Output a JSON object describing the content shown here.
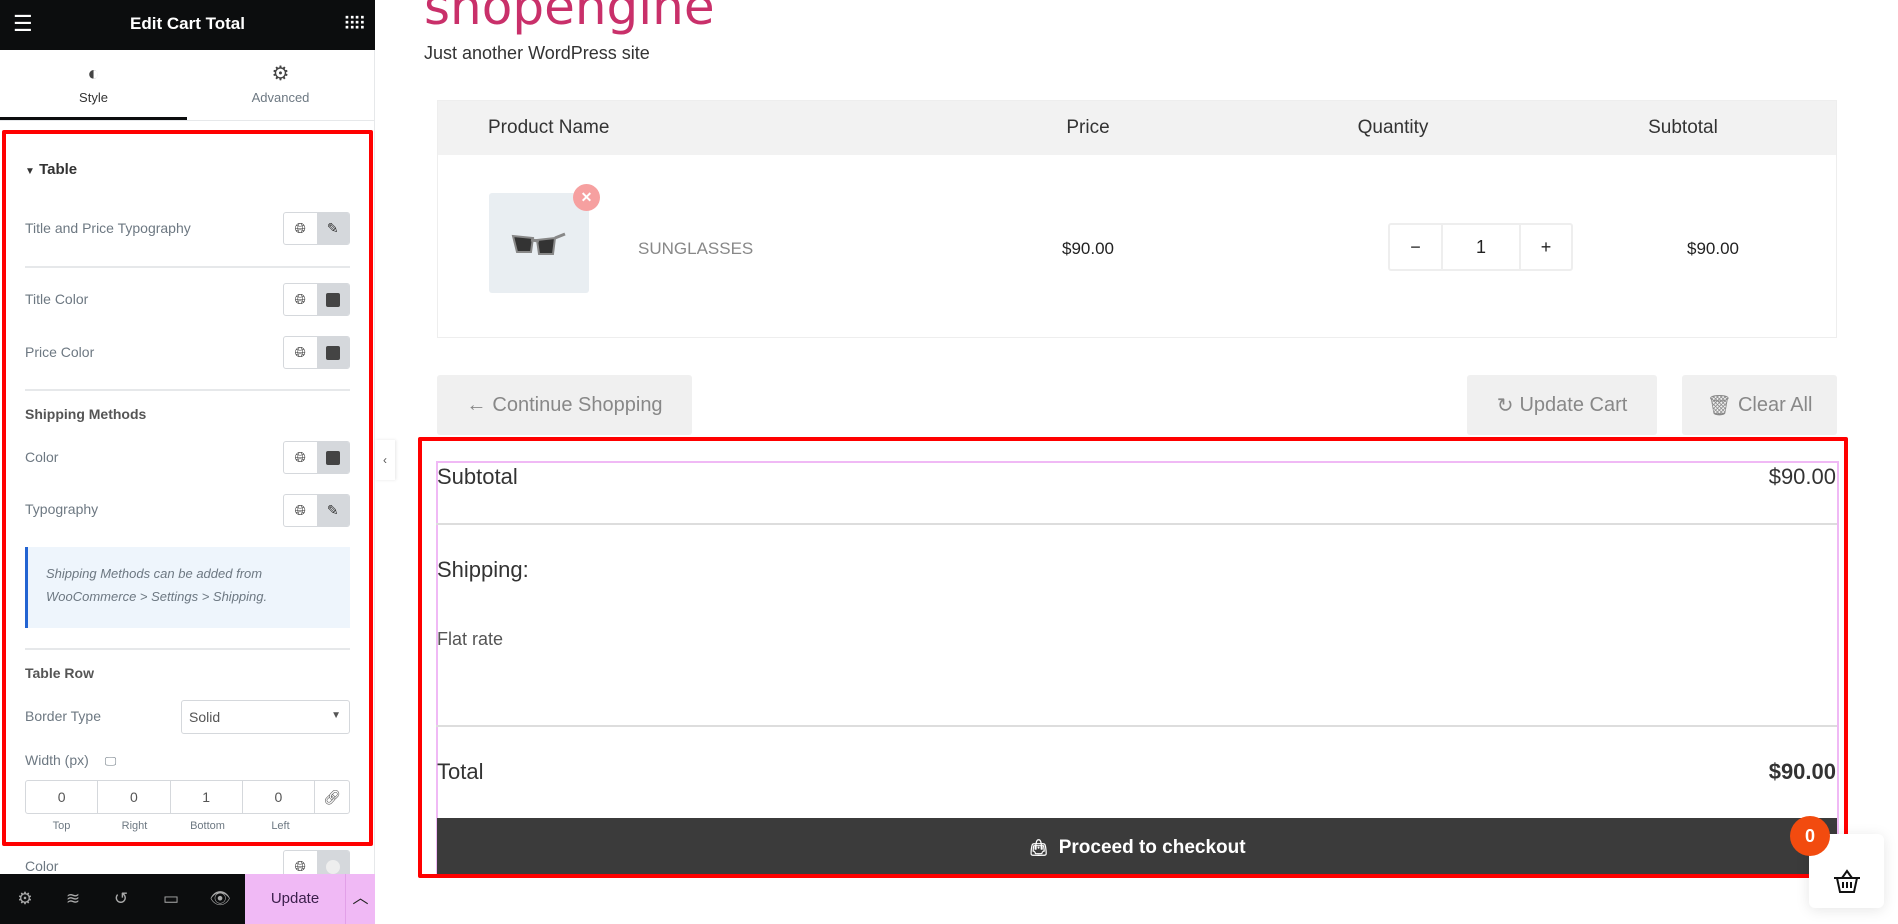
{
  "panel": {
    "title": "Edit Cart Total",
    "tabs": [
      {
        "label": "Style"
      },
      {
        "label": "Advanced"
      }
    ],
    "section": "Table",
    "controls": {
      "title_price_typography": "Title and Price Typography",
      "title_color": "Title Color",
      "price_color": "Price Color",
      "shipping_methods": "Shipping Methods",
      "color": "Color",
      "typography": "Typography",
      "info": "Shipping Methods can be added from WooCommerce > Settings > Shipping.",
      "table_row": "Table Row",
      "border_type": "Border Type",
      "border_type_value": "Solid",
      "width_label": "Width (px)",
      "dims": [
        {
          "value": "0",
          "label": "Top"
        },
        {
          "value": "0",
          "label": "Right"
        },
        {
          "value": "1",
          "label": "Bottom"
        },
        {
          "value": "0",
          "label": "Left"
        }
      ],
      "row_color": "Color"
    },
    "update": "Update"
  },
  "site": {
    "title": "shopengine",
    "tagline": "Just another WordPress site"
  },
  "cart": {
    "headers": [
      "Product Name",
      "Price",
      "Quantity",
      "Subtotal"
    ],
    "item": {
      "name": "SUNGLASSES",
      "price": "$90.00",
      "qty": "1",
      "subtotal": "$90.00"
    },
    "continue": "Continue Shopping",
    "update": "Update Cart",
    "clear": "Clear All"
  },
  "totals": {
    "subtotal_label": "Subtotal",
    "subtotal": "$90.00",
    "shipping_label": "Shipping:",
    "shipping_method": "Flat rate",
    "total_label": "Total",
    "total": "$90.00",
    "checkout": "Proceed to checkout"
  },
  "mini_cart": {
    "count": "0"
  },
  "colors": {
    "brand": "#c9306a",
    "update": "#f0b9f5",
    "badge": "#f24b0f"
  }
}
